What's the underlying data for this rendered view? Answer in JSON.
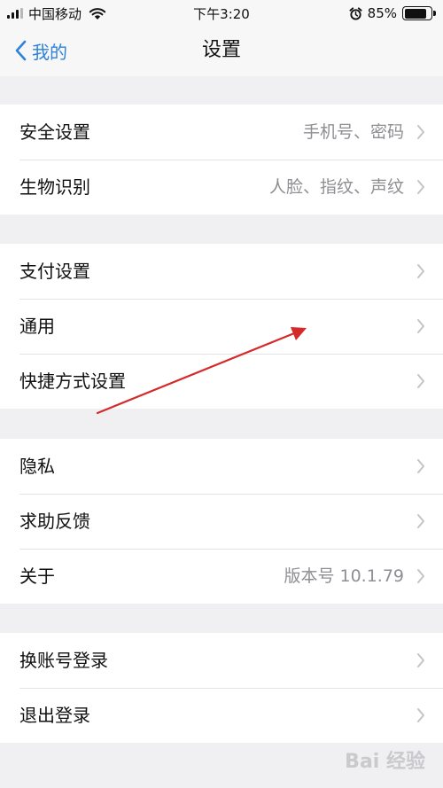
{
  "status_bar": {
    "carrier": "中国移动",
    "time": "下午3:20",
    "battery_text": "85%",
    "battery_level": 0.85,
    "signal_bars": 3,
    "icons": [
      "signal-icon",
      "wifi-icon",
      "alarm-icon",
      "battery-icon"
    ]
  },
  "nav": {
    "back_label": "我的",
    "title": "设置",
    "back_icon": "chevron-left-icon"
  },
  "groups": [
    {
      "rows": [
        {
          "label": "安全设置",
          "value": "手机号、密码"
        },
        {
          "label": "生物识别",
          "value": "人脸、指纹、声纹"
        }
      ]
    },
    {
      "rows": [
        {
          "label": "支付设置",
          "value": ""
        },
        {
          "label": "通用",
          "value": ""
        },
        {
          "label": "快捷方式设置",
          "value": ""
        }
      ]
    },
    {
      "rows": [
        {
          "label": "隐私",
          "value": ""
        },
        {
          "label": "求助反馈",
          "value": ""
        },
        {
          "label": "关于",
          "value": "版本号 10.1.79"
        }
      ]
    },
    {
      "rows": [
        {
          "label": "换账号登录",
          "value": ""
        },
        {
          "label": "退出登录",
          "value": ""
        }
      ]
    }
  ],
  "watermark": "Bai 经验",
  "colors": {
    "accent": "#2e82d9",
    "background": "#f0f0f3",
    "secondary_text": "#8e8e93",
    "annotation_arrow": "#d42a2a"
  }
}
